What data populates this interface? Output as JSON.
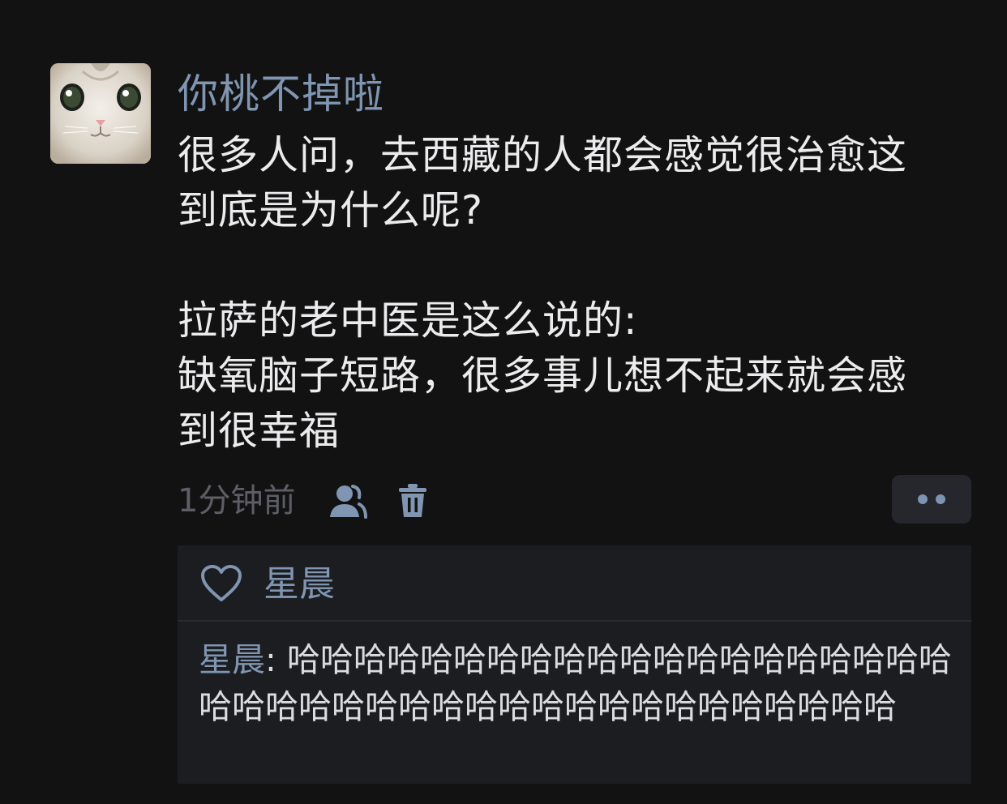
{
  "post": {
    "username": "你桃不掉啦",
    "avatar_icon": "cat-avatar-icon",
    "content_lines": [
      "很多人问，去西藏的人都会感觉很治愈这",
      "到底是为什么呢?",
      "",
      "拉萨的老中医是这么说的:",
      "缺氧脑子短路，很多事儿想不起来就会感",
      "到很幸福"
    ],
    "timestamp": "1分钟前",
    "friends_icon": "friends-visibility-icon",
    "delete_icon": "trash-icon",
    "more_icon": "more-dots-icon"
  },
  "comments": {
    "like_icon": "heart-outline-icon",
    "liked_by": "星晨",
    "reply_author": "星晨",
    "reply_separator": ": ",
    "reply_text": "哈哈哈哈哈哈哈哈哈哈哈哈哈哈哈哈哈哈哈哈哈哈哈哈哈哈哈哈哈哈哈哈哈哈哈哈哈哈哈哈哈"
  },
  "colors": {
    "background": "#121212",
    "name_blue": "#7f95b1",
    "text": "#ececee",
    "muted": "#5e5f66",
    "comment_bg": "#1c1d20"
  }
}
